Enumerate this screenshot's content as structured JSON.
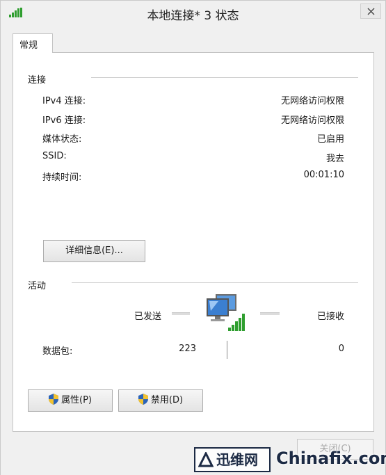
{
  "window": {
    "title": "本地连接* 3 状态"
  },
  "tabs": [
    {
      "label": "常规"
    }
  ],
  "connection": {
    "section_label": "连接",
    "rows": [
      {
        "label": "IPv4 连接:",
        "value": "无网络访问权限"
      },
      {
        "label": "IPv6 连接:",
        "value": "无网络访问权限"
      },
      {
        "label": "媒体状态:",
        "value": "已启用"
      },
      {
        "label": "SSID:",
        "value": "我去"
      },
      {
        "label": "持续时间:",
        "value": "00:01:10"
      }
    ],
    "details_button": "详细信息(E)..."
  },
  "activity": {
    "section_label": "活动",
    "sent_label": "已发送",
    "received_label": "已接收",
    "packets_label": "数据包:",
    "packets_sent": "223",
    "packets_received": "0"
  },
  "buttons": {
    "properties": "属性(P)",
    "disable": "禁用(D)",
    "close": "关闭(C)"
  },
  "watermark": {
    "logo_text": "迅维网",
    "site_text": "Chinafix.com"
  },
  "colors": {
    "signal_green": "#2f9e2f",
    "monitor_blue": "#3b7fd1",
    "shield_blue": "#2a63b8",
    "shield_yellow": "#f2c230"
  }
}
